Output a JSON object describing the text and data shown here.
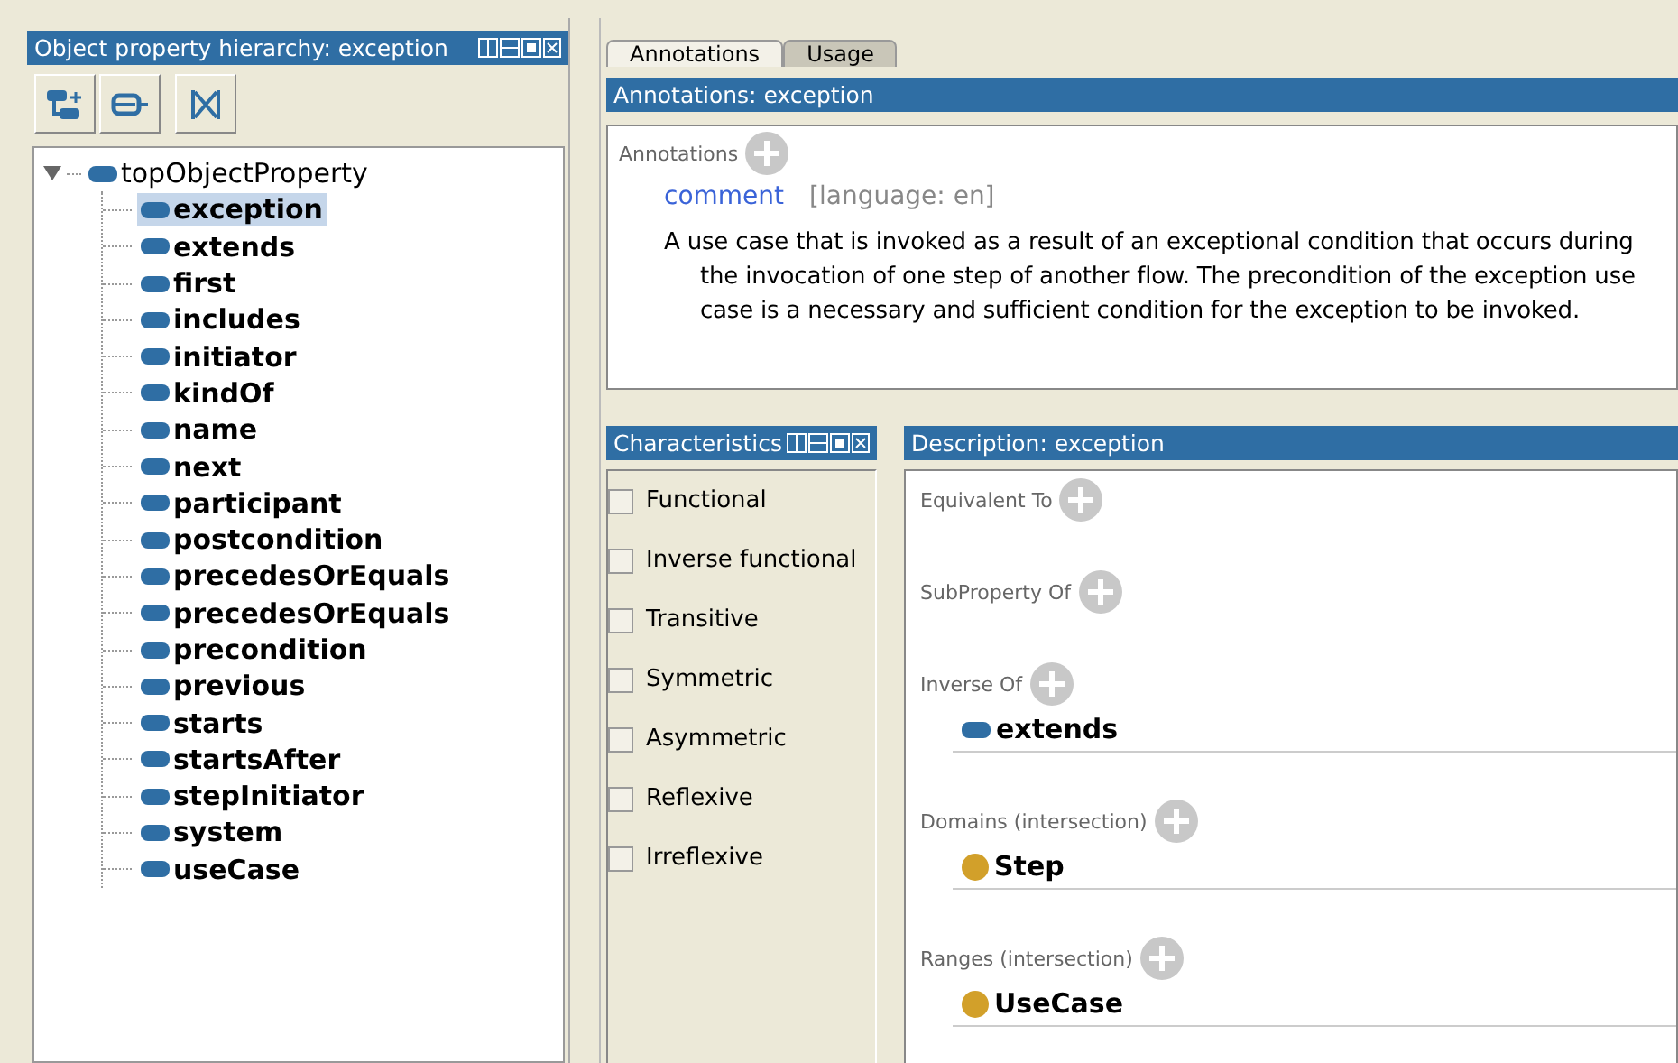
{
  "hierarchy": {
    "title": "Object property hierarchy: exception",
    "tree": {
      "label": "topObjectProperty",
      "expanded": true,
      "children": [
        {
          "label": "exception",
          "selected": true
        },
        {
          "label": "extends",
          "selected": false
        },
        {
          "label": "first",
          "selected": false
        },
        {
          "label": "includes",
          "selected": false
        },
        {
          "label": "initiator",
          "selected": false
        },
        {
          "label": "kindOf",
          "selected": false
        },
        {
          "label": "name",
          "selected": false
        },
        {
          "label": "next",
          "selected": false
        },
        {
          "label": "participant",
          "selected": false
        },
        {
          "label": "postcondition",
          "selected": false
        },
        {
          "label": "precedesOrEquals",
          "selected": false
        },
        {
          "label": "precedesOrEquals",
          "selected": false
        },
        {
          "label": "precondition",
          "selected": false
        },
        {
          "label": "previous",
          "selected": false
        },
        {
          "label": "starts",
          "selected": false
        },
        {
          "label": "startsAfter",
          "selected": false
        },
        {
          "label": "stepInitiator",
          "selected": false
        },
        {
          "label": "system",
          "selected": false
        },
        {
          "label": "useCase",
          "selected": false
        }
      ]
    }
  },
  "tabs": [
    {
      "label": "Annotations",
      "selected": true
    },
    {
      "label": "Usage",
      "selected": false
    }
  ],
  "annotations": {
    "title": "Annotations: exception",
    "section_label": "Annotations",
    "items": [
      {
        "property": "comment",
        "language": "[language: en]",
        "text": "A use case that is invoked as a result of an exceptional condition that occurs during the invocation of one step of another flow. The precondition of the exception use case is a necessary and sufficient condition for the exception to be invoked."
      }
    ]
  },
  "characteristics": {
    "title": "Characteristics",
    "items": [
      {
        "label": "Functional",
        "checked": false
      },
      {
        "label": "Inverse functional",
        "checked": false
      },
      {
        "label": "Transitive",
        "checked": false
      },
      {
        "label": "Symmetric",
        "checked": false
      },
      {
        "label": "Asymmetric",
        "checked": false
      },
      {
        "label": "Reflexive",
        "checked": false
      },
      {
        "label": "Irreflexive",
        "checked": false
      }
    ]
  },
  "description": {
    "title": "Description: exception",
    "sections": [
      {
        "label": "Equivalent To"
      },
      {
        "label": "SubProperty Of"
      },
      {
        "label": "Inverse Of",
        "items": [
          {
            "kind": "property",
            "label": "extends"
          }
        ]
      },
      {
        "label": "Domains (intersection)",
        "items": [
          {
            "kind": "class",
            "label": "Step"
          }
        ]
      },
      {
        "label": "Ranges (intersection)",
        "items": [
          {
            "kind": "class",
            "label": "UseCase"
          }
        ]
      }
    ]
  }
}
